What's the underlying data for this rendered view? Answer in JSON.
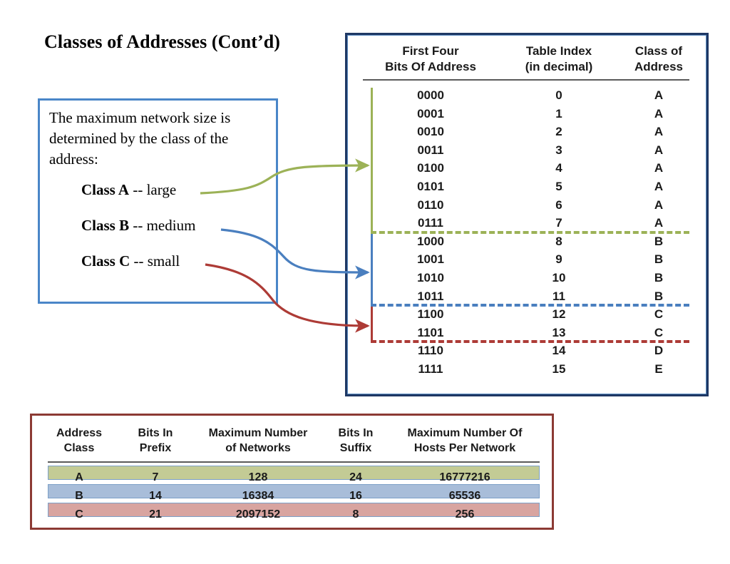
{
  "slide": {
    "title": "Classes of Addresses (Cont’d)"
  },
  "explanation": {
    "lead": "The maximum network size is determined by the class of the address:",
    "items": [
      {
        "name": "Class A",
        "desc": " -- large"
      },
      {
        "name": "Class B",
        "desc": " -- medium"
      },
      {
        "name": "Class C",
        "desc": " -- small"
      }
    ]
  },
  "bits_table": {
    "headers": [
      "First Four\nBits Of Address",
      "Table Index\n(in decimal)",
      "Class of\nAddress"
    ],
    "header_lines": {
      "col0_line1": "First Four",
      "col0_line2": "Bits Of Address",
      "col1_line1": "Table Index",
      "col1_line2": "(in decimal)",
      "col2_line1": "Class of",
      "col2_line2": "Address"
    },
    "rows": [
      {
        "bits": "0000",
        "index": "0",
        "class": "A"
      },
      {
        "bits": "0001",
        "index": "1",
        "class": "A"
      },
      {
        "bits": "0010",
        "index": "2",
        "class": "A"
      },
      {
        "bits": "0011",
        "index": "3",
        "class": "A"
      },
      {
        "bits": "0100",
        "index": "4",
        "class": "A"
      },
      {
        "bits": "0101",
        "index": "5",
        "class": "A"
      },
      {
        "bits": "0110",
        "index": "6",
        "class": "A"
      },
      {
        "bits": "0111",
        "index": "7",
        "class": "A"
      },
      {
        "bits": "1000",
        "index": "8",
        "class": "B"
      },
      {
        "bits": "1001",
        "index": "9",
        "class": "B"
      },
      {
        "bits": "1010",
        "index": "10",
        "class": "B"
      },
      {
        "bits": "1011",
        "index": "11",
        "class": "B"
      },
      {
        "bits": "1100",
        "index": "12",
        "class": "C"
      },
      {
        "bits": "1101",
        "index": "13",
        "class": "C"
      },
      {
        "bits": "1110",
        "index": "14",
        "class": "D"
      },
      {
        "bits": "1111",
        "index": "15",
        "class": "E"
      }
    ]
  },
  "summary_table": {
    "headers": [
      "Address\nClass",
      "Bits In\nPrefix",
      "Maximum Number\nof Networks",
      "Bits In\nSuffix",
      "Maximum Number Of\nHosts Per Network"
    ],
    "header_lines": {
      "col0_line1": "Address",
      "col0_line2": "Class",
      "col1_line1": "Bits In",
      "col1_line2": "Prefix",
      "col2_line1": "Maximum Number",
      "col2_line2": "of Networks",
      "col3_line1": "Bits In",
      "col3_line2": "Suffix",
      "col4_line1": "Maximum Number Of",
      "col4_line2": "Hosts Per Network"
    },
    "rows": [
      {
        "address_class": "A",
        "bits_prefix": "7",
        "max_networks": "128",
        "bits_suffix": "24",
        "max_hosts": "16777216"
      },
      {
        "address_class": "B",
        "bits_prefix": "14",
        "max_networks": "16384",
        "bits_suffix": "16",
        "max_hosts": "65536"
      },
      {
        "address_class": "C",
        "bits_prefix": "21",
        "max_networks": "2097152",
        "bits_suffix": "8",
        "max_hosts": "256"
      }
    ]
  },
  "colors": {
    "class_a_green": "#9cb257",
    "class_b_blue": "#4a7fbf",
    "class_c_red": "#ad3b36",
    "table_border_navy": "#1f3864",
    "textbox_border_blue": "#4a86c8",
    "summary_border_maroon": "#8c3a34",
    "band_a": "#c3cb95",
    "band_b": "#a8bdd9",
    "band_c": "#d8a4a0"
  }
}
